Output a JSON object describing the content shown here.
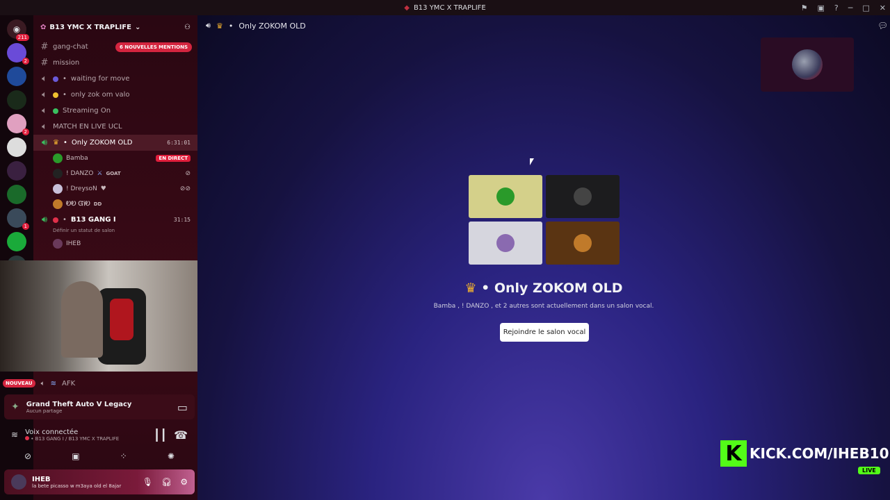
{
  "window": {
    "title": "B13 YMC X TRAPLIFE"
  },
  "servers": {
    "home_badge": "211",
    "items": [
      {
        "color": "#6a4bd8",
        "badge": "2"
      },
      {
        "color": "#1f4a9a",
        "badge": ""
      },
      {
        "color": "#1a2a1a",
        "badge": ""
      },
      {
        "color": "#e0a0c0",
        "badge": "2"
      },
      {
        "color": "#dddddd",
        "badge": ""
      },
      {
        "color": "#3a2040",
        "badge": ""
      },
      {
        "color": "#1a6a2a",
        "badge": ""
      },
      {
        "color": "#3a4a5a",
        "badge": "1"
      },
      {
        "color": "#1aaa3a",
        "badge": ""
      },
      {
        "color": "#2a3a3a",
        "badge": ""
      }
    ]
  },
  "guild": {
    "name": "B13 YMC X TRAPLIFE"
  },
  "mentions_pill": "6 NOUVELLES MENTIONS",
  "channels": {
    "gang_chat": "gang-chat",
    "mission": "mission",
    "waiting": "waiting for move",
    "valo": "only zok om valo",
    "streaming": "Streaming On",
    "match": "MATCH EN LIVE UCL",
    "zokom": "Only ZOKOM OLD",
    "zokom_time": "6:31:01",
    "gang": "B13 GANG I",
    "gang_time": "31:15",
    "gang_status": "Définir un statut de salon"
  },
  "members": {
    "bamba": "Bamba",
    "live": "EN DIRECT",
    "danzo": "! DANZO",
    "danzo_tag": "GOAT",
    "dreyson": "! DreysoN",
    "gio": "ᎧᎧ ᏳᎥᎧ",
    "gio_tag": "DD",
    "iheb": "IHEB"
  },
  "afk": {
    "new_label": "NOUVEAU",
    "label": "AFK"
  },
  "activity": {
    "game": "Grand Theft Auto V Legacy",
    "status": "Aucun partage"
  },
  "voice": {
    "title": "Voix connectée",
    "location": "B13 GANG I / B13 YMC X TRAPLIFE"
  },
  "user": {
    "name": "IHEB",
    "status": "la bete picasso w m3aya old el 8ajar"
  },
  "main": {
    "header": "Only ZOKOM OLD",
    "title": "Only ZOKOM OLD",
    "subtitle": "Bamba , ! DANZO , et 2 autres sont actuellement dans un salon vocal.",
    "join": "Rejoindre le salon vocal",
    "tiles": [
      {
        "bg": "#d4d08a",
        "av": "#2a9a2a"
      },
      {
        "bg": "#1c1c1e",
        "av": "#444444"
      },
      {
        "bg": "#d6d6de",
        "av": "#8a6ab0"
      },
      {
        "bg": "#5a3412",
        "av": "#c07a2a"
      }
    ]
  },
  "kick": {
    "logo": "K",
    "text": "KICK.COM/IHEB10",
    "live": "LIVE"
  }
}
